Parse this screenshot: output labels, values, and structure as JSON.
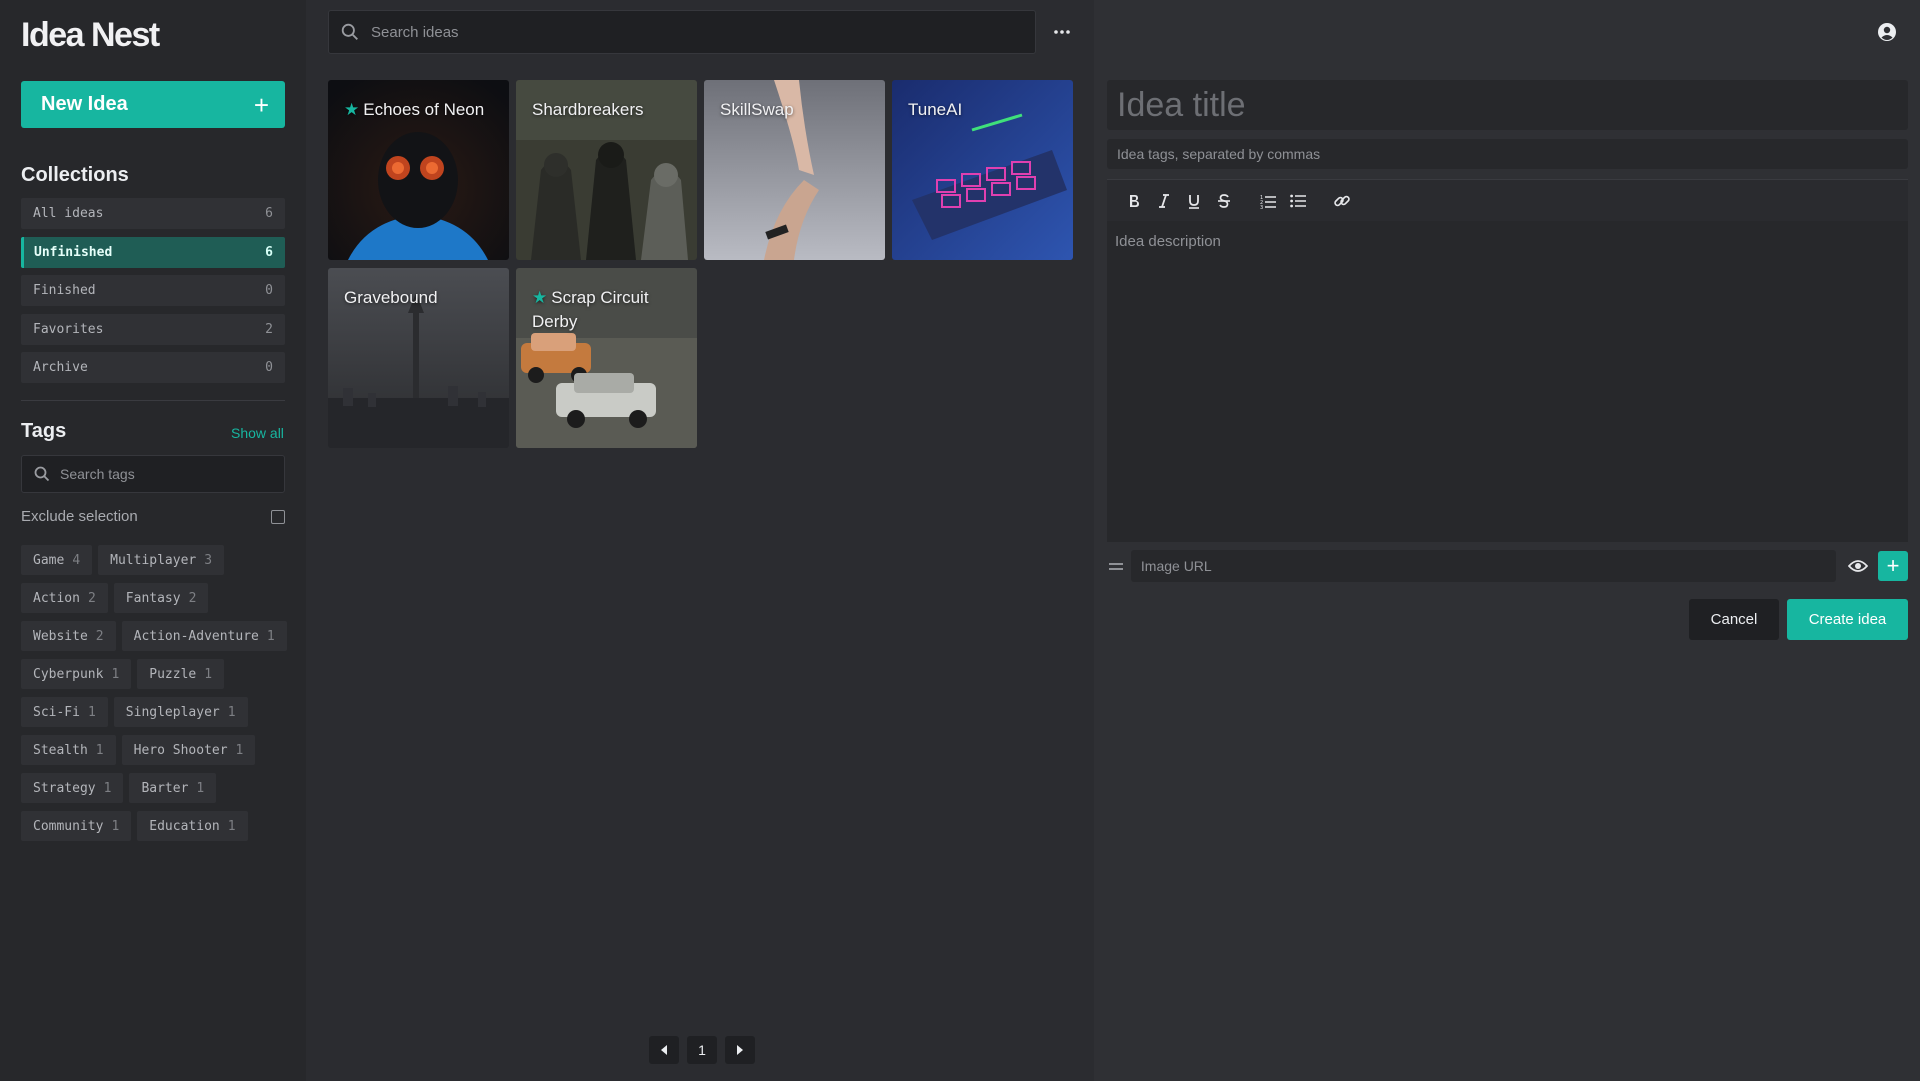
{
  "app": {
    "title": "Idea Nest"
  },
  "sidebar": {
    "new_idea_label": "New Idea",
    "collections_heading": "Collections",
    "collections": [
      {
        "label": "All ideas",
        "count": "6"
      },
      {
        "label": "Unfinished",
        "count": "6",
        "active": true
      },
      {
        "label": "Finished",
        "count": "0"
      },
      {
        "label": "Favorites",
        "count": "2"
      },
      {
        "label": "Archive",
        "count": "0"
      }
    ],
    "tags_heading": "Tags",
    "show_all_label": "Show all",
    "tag_search_placeholder": "Search tags",
    "exclude_label": "Exclude selection",
    "tags": [
      {
        "name": "Game",
        "count": "4"
      },
      {
        "name": "Multiplayer",
        "count": "3"
      },
      {
        "name": "Action",
        "count": "2"
      },
      {
        "name": "Fantasy",
        "count": "2"
      },
      {
        "name": "Website",
        "count": "2"
      },
      {
        "name": "Action-Adventure",
        "count": "1"
      },
      {
        "name": "Cyberpunk",
        "count": "1"
      },
      {
        "name": "Puzzle",
        "count": "1"
      },
      {
        "name": "Sci-Fi",
        "count": "1"
      },
      {
        "name": "Singleplayer",
        "count": "1"
      },
      {
        "name": "Stealth",
        "count": "1"
      },
      {
        "name": "Hero Shooter",
        "count": "1"
      },
      {
        "name": "Strategy",
        "count": "1"
      },
      {
        "name": "Barter",
        "count": "1"
      },
      {
        "name": "Community",
        "count": "1"
      },
      {
        "name": "Education",
        "count": "1"
      }
    ]
  },
  "main": {
    "search_placeholder": "Search ideas",
    "ideas": [
      {
        "title": "Echoes of Neon",
        "favorite": true
      },
      {
        "title": "Shardbreakers",
        "favorite": false
      },
      {
        "title": "SkillSwap",
        "favorite": false
      },
      {
        "title": "TuneAI",
        "favorite": false
      },
      {
        "title": "Gravebound",
        "favorite": false
      },
      {
        "title": "Scrap Circuit Derby",
        "favorite": true
      }
    ],
    "pagination": {
      "current_page": "1"
    }
  },
  "editor": {
    "title_placeholder": "Idea title",
    "tags_placeholder": "Idea tags, separated by commas",
    "description_placeholder": "Idea description",
    "image_url_placeholder": "Image URL",
    "cancel_label": "Cancel",
    "create_label": "Create idea",
    "toolbar_icons": [
      "bold-icon",
      "italic-icon",
      "underline-icon",
      "strikethrough-icon",
      "ordered-list-icon",
      "bullet-list-icon",
      "link-icon"
    ]
  },
  "colors": {
    "accent": "#17b6a0",
    "background": "#2b2c30",
    "sidebar": "#27282b",
    "panel": "#2f3034"
  }
}
